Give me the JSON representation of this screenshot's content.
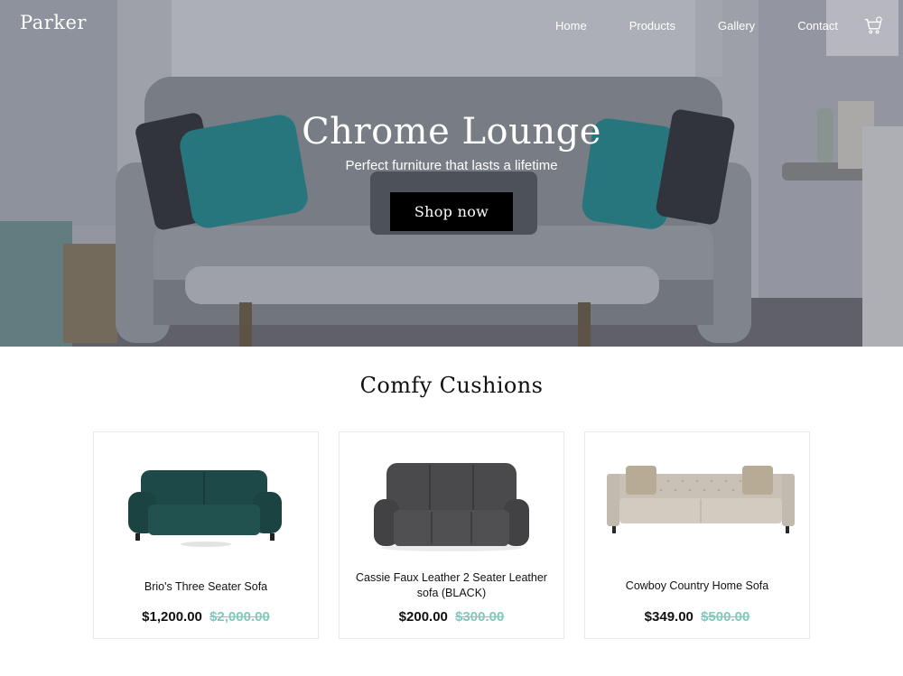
{
  "nav": {
    "brand": "Parker",
    "links": [
      "Home",
      "Products",
      "Gallery",
      "Contact"
    ],
    "cart_icon": "shopping-cart-icon"
  },
  "hero": {
    "title": "Chrome Lounge",
    "subtitle": "Perfect furniture that lasts a lifetime",
    "cta": "Shop now"
  },
  "section": {
    "title": "Comfy Cushions"
  },
  "products": [
    {
      "name": "Brio's Three Seater Sofa",
      "price": "$1,200.00",
      "old_price": "$2,000.00",
      "color": "#1d4a48"
    },
    {
      "name": "Cassie Faux Leather 2 Seater Leather sofa (BLACK)",
      "price": "$200.00",
      "old_price": "$300.00",
      "color": "#4a4a4c"
    },
    {
      "name": "Cowboy Country Home Sofa",
      "price": "$349.00",
      "old_price": "$500.00",
      "color": "#c9c1b5"
    }
  ],
  "colors": {
    "accent_strike": "#7fc9bd",
    "button_bg": "#000000",
    "cushion_teal": "#1f8a8f"
  }
}
